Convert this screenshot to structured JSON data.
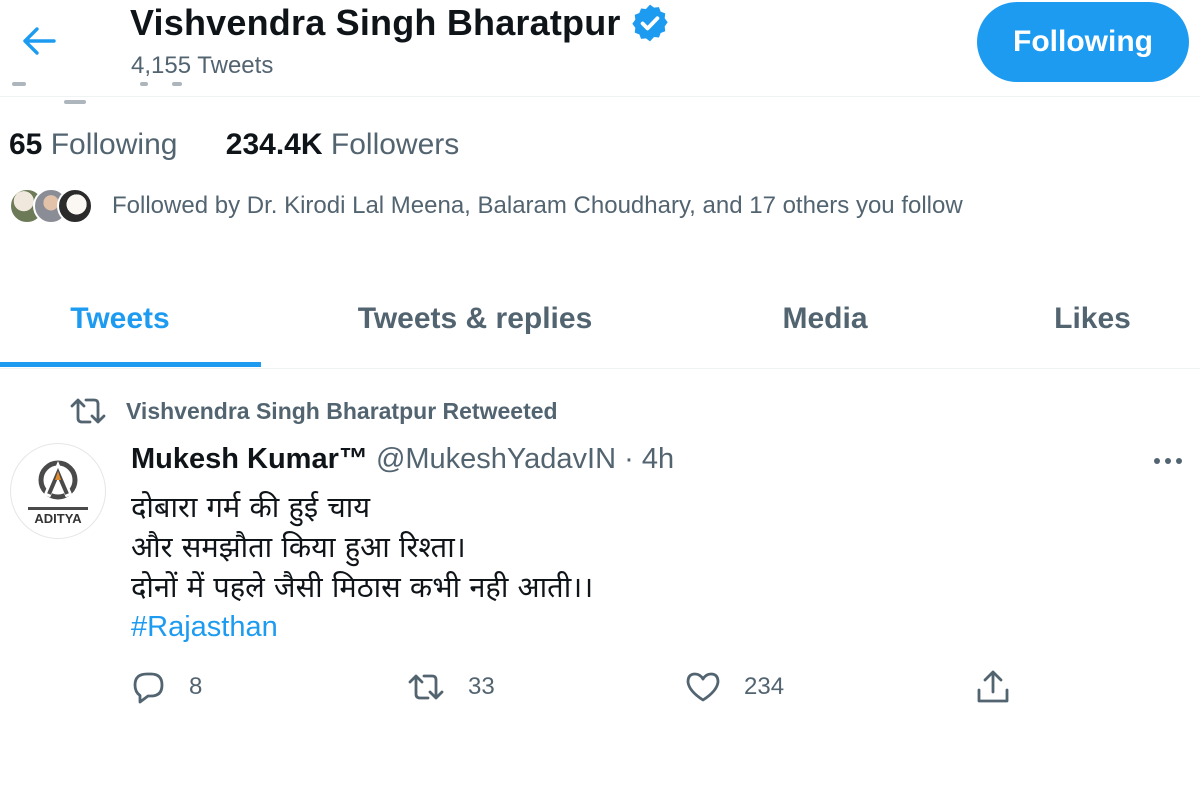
{
  "header": {
    "name": "Vishvendra Singh Bharatpur",
    "tweet_count": "4,155 Tweets",
    "follow_button": "Following"
  },
  "stats": {
    "following_count": "65",
    "following_label": "Following",
    "followers_count": "234.4K",
    "followers_label": "Followers"
  },
  "followed_by": "Followed by Dr. Kirodi Lal Meena, Balaram Choudhary, and 17 others you follow",
  "tabs": [
    {
      "label": "Tweets",
      "active": true
    },
    {
      "label": "Tweets & replies",
      "active": false
    },
    {
      "label": "Media",
      "active": false
    },
    {
      "label": "Likes",
      "active": false
    }
  ],
  "tweet": {
    "retweet_note": "Vishvendra Singh Bharatpur Retweeted",
    "author_name": "Mukesh Kumar™",
    "author_handle": "@MukeshYadavIN",
    "separator": "·",
    "time": "4h",
    "avatar_text": "ADITYA",
    "lines": [
      "दोबारा गर्म की हुई चाय",
      "और समझौता किया हुआ रिश्ता।",
      "दोनों में पहले जैसी मिठास कभी नही आती।।"
    ],
    "hashtag": "#Rajasthan",
    "replies": "8",
    "retweets": "33",
    "likes": "234"
  },
  "colors": {
    "accent": "#1d9bf0",
    "muted": "#536471",
    "text": "#0f1419"
  },
  "icons": [
    "back-arrow-icon",
    "verified-badge-icon",
    "retweet-icon",
    "reply-icon",
    "like-icon",
    "share-icon",
    "more-icon"
  ]
}
